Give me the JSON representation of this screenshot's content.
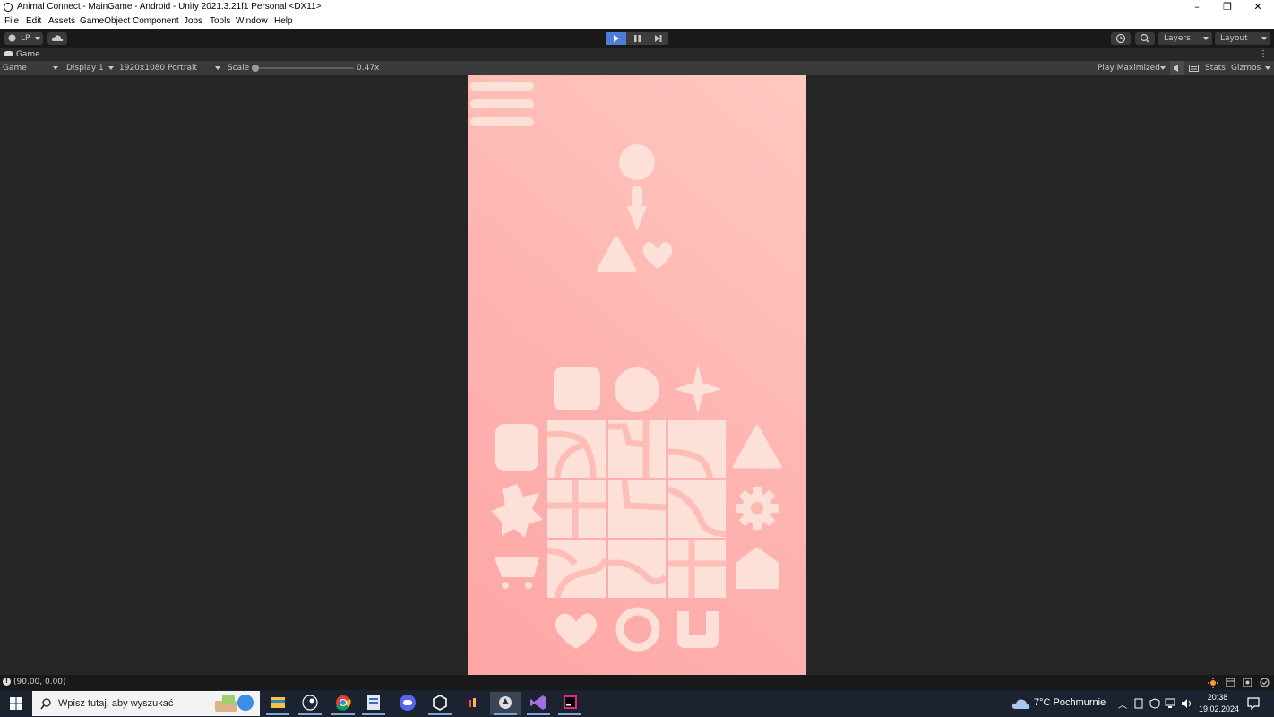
{
  "window": {
    "title": "Animal Connect - MainGame - Android - Unity 2021.3.21f1 Personal <DX11>",
    "controls": [
      "–",
      "❐",
      "✕"
    ]
  },
  "menu": [
    "File",
    "Edit",
    "Assets",
    "GameObject",
    "Component",
    "Jobs",
    "Tools",
    "Window",
    "Help"
  ],
  "toolbar": {
    "account": "LP",
    "layers": "Layers",
    "layout": "Layout"
  },
  "game_tab": {
    "label": "Game",
    "mode": "Game",
    "display": "Display 1",
    "resolution": "1920x1080 Portrait",
    "scale_label": "Scale",
    "scale_value": "0.47x",
    "scale_fraction": 0.0,
    "play_maximized": "Play Maximized",
    "stats": "Stats",
    "gizmos": "Gizmos"
  },
  "status": {
    "message": "(90.00, 0.00)"
  },
  "taskbar": {
    "search_placeholder": "Wpisz tutaj, aby wyszukać",
    "weather": "7°C  Pochmurnie",
    "time": "20:38",
    "date": "19.02.2024"
  },
  "colors": {
    "editor_bg": "#262626",
    "toolbar_bg": "#191919",
    "game_bg_start": "#fea6a6",
    "game_bg_end": "#fec9c0",
    "shape_color": "#fde0d8",
    "play_accent": "#4c7ed8"
  }
}
